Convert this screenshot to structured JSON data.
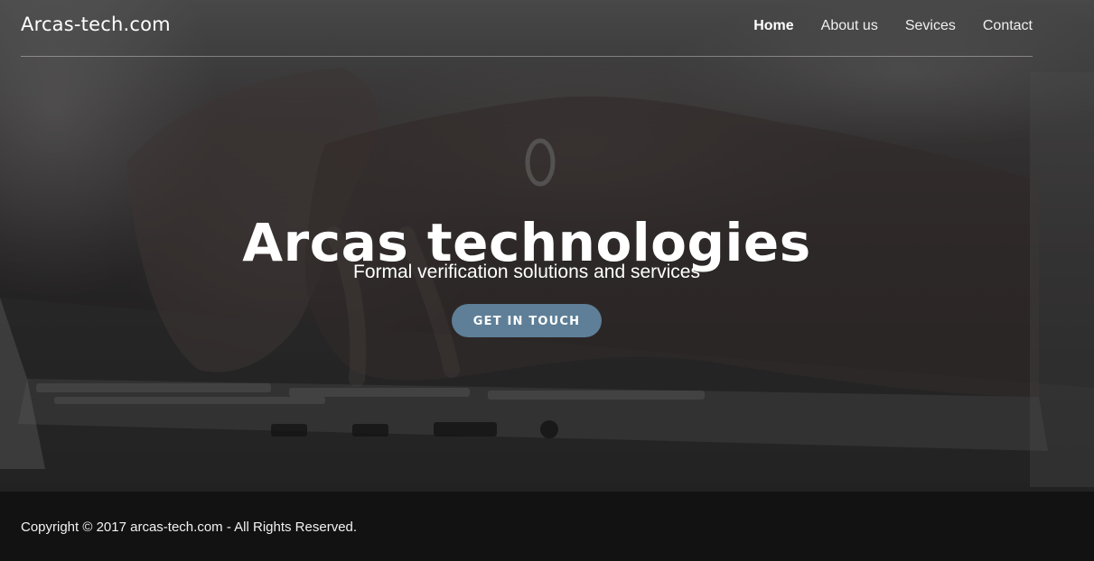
{
  "header": {
    "brand": "Arcas-tech.com",
    "nav": [
      {
        "label": "Home",
        "active": true
      },
      {
        "label": "About us",
        "active": false
      },
      {
        "label": "Sevices",
        "active": false
      },
      {
        "label": "Contact",
        "active": false
      }
    ]
  },
  "hero": {
    "title": "Arcas technologies",
    "subtitle": "Formal verification solutions and services",
    "cta_label": "GET IN TOUCH",
    "background_image": "hands-typing-on-laptop"
  },
  "footer": {
    "copyright": "Copyright © 2017 arcas-tech.com - All Rights Reserved."
  },
  "colors": {
    "cta": "#5e7f97",
    "footer_bg": "#121212",
    "text": "#ffffff"
  }
}
